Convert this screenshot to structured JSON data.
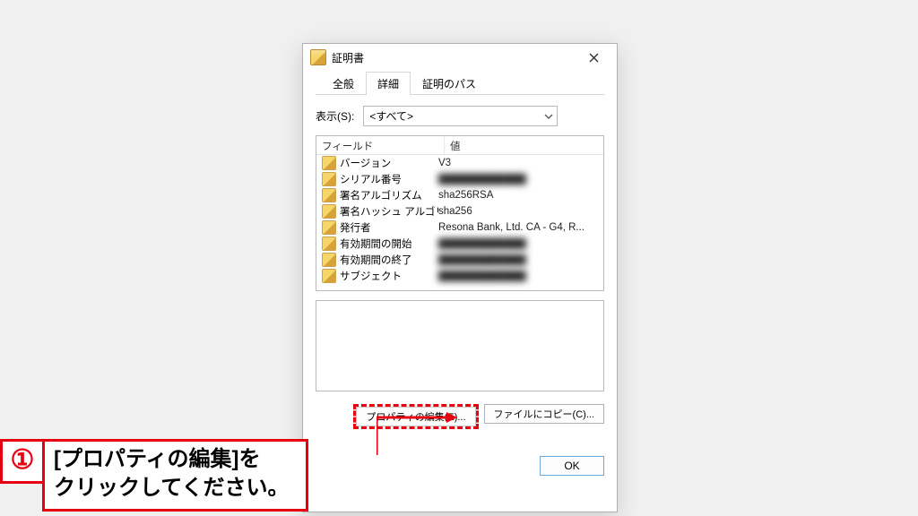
{
  "dialog": {
    "title": "証明書",
    "tabs": [
      "全般",
      "詳細",
      "証明のパス"
    ],
    "active_tab": 1,
    "show_label": "表示(S):",
    "show_combo": "<すべて>",
    "columns": {
      "c1": "フィールド",
      "c2": "値"
    },
    "rows": [
      {
        "field": "バージョン",
        "value": "V3",
        "blur": false
      },
      {
        "field": "シリアル番号",
        "value": "████████████",
        "blur": true
      },
      {
        "field": "署名アルゴリズム",
        "value": "sha256RSA",
        "blur": false
      },
      {
        "field": "署名ハッシュ アルゴリズム",
        "value": "sha256",
        "blur": false
      },
      {
        "field": "発行者",
        "value": "Resona Bank, Ltd. CA - G4, R...",
        "blur": false
      },
      {
        "field": "有効期間の開始",
        "value": "████████████",
        "blur": true
      },
      {
        "field": "有効期間の終了",
        "value": "████████████",
        "blur": true
      },
      {
        "field": "サブジェクト",
        "value": "████████████",
        "blur": true
      }
    ],
    "buttons": {
      "edit_props": "プロパティの編集(E)...",
      "copy_file": "ファイルにコピー(C)...",
      "ok": "OK"
    }
  },
  "callout": {
    "number": "①",
    "line1": "[プロパティの編集]を",
    "line2": "クリックしてください。"
  }
}
